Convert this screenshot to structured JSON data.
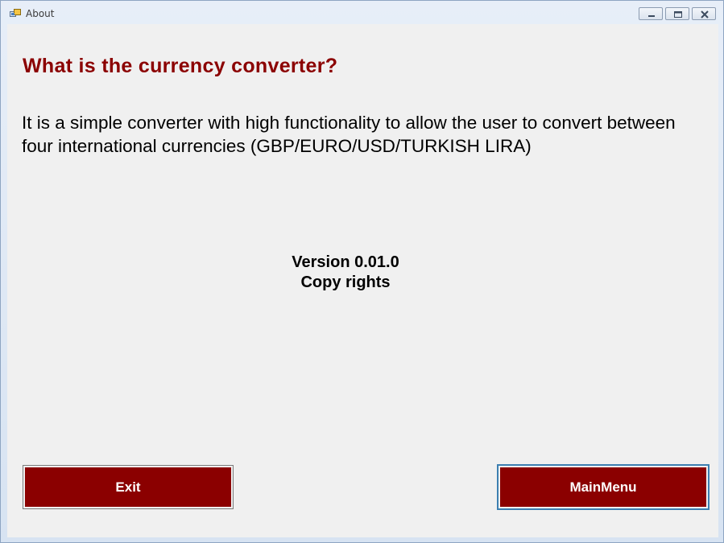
{
  "window": {
    "title": "About",
    "app_icon": "window-app-icon",
    "controls": {
      "minimize_icon": "minimize-icon",
      "maximize_icon": "maximize-icon",
      "close_icon": "close-icon"
    }
  },
  "content": {
    "heading": "What is the currency converter?",
    "description_line1": "It is a simple converter with high functionality to allow the user to convert between",
    "description_line2": "four international currencies (GBP/EURO/USD/TURKISH LIRA)",
    "version": "Version 0.01.0",
    "copyright": "Copy rights"
  },
  "buttons": {
    "exit_label": "Exit",
    "mainmenu_label": "MainMenu"
  },
  "colors": {
    "accent": "#8b0000",
    "background": "#f0f0f0",
    "button_text": "#ffffff",
    "focus_border": "#3c7fb1"
  }
}
